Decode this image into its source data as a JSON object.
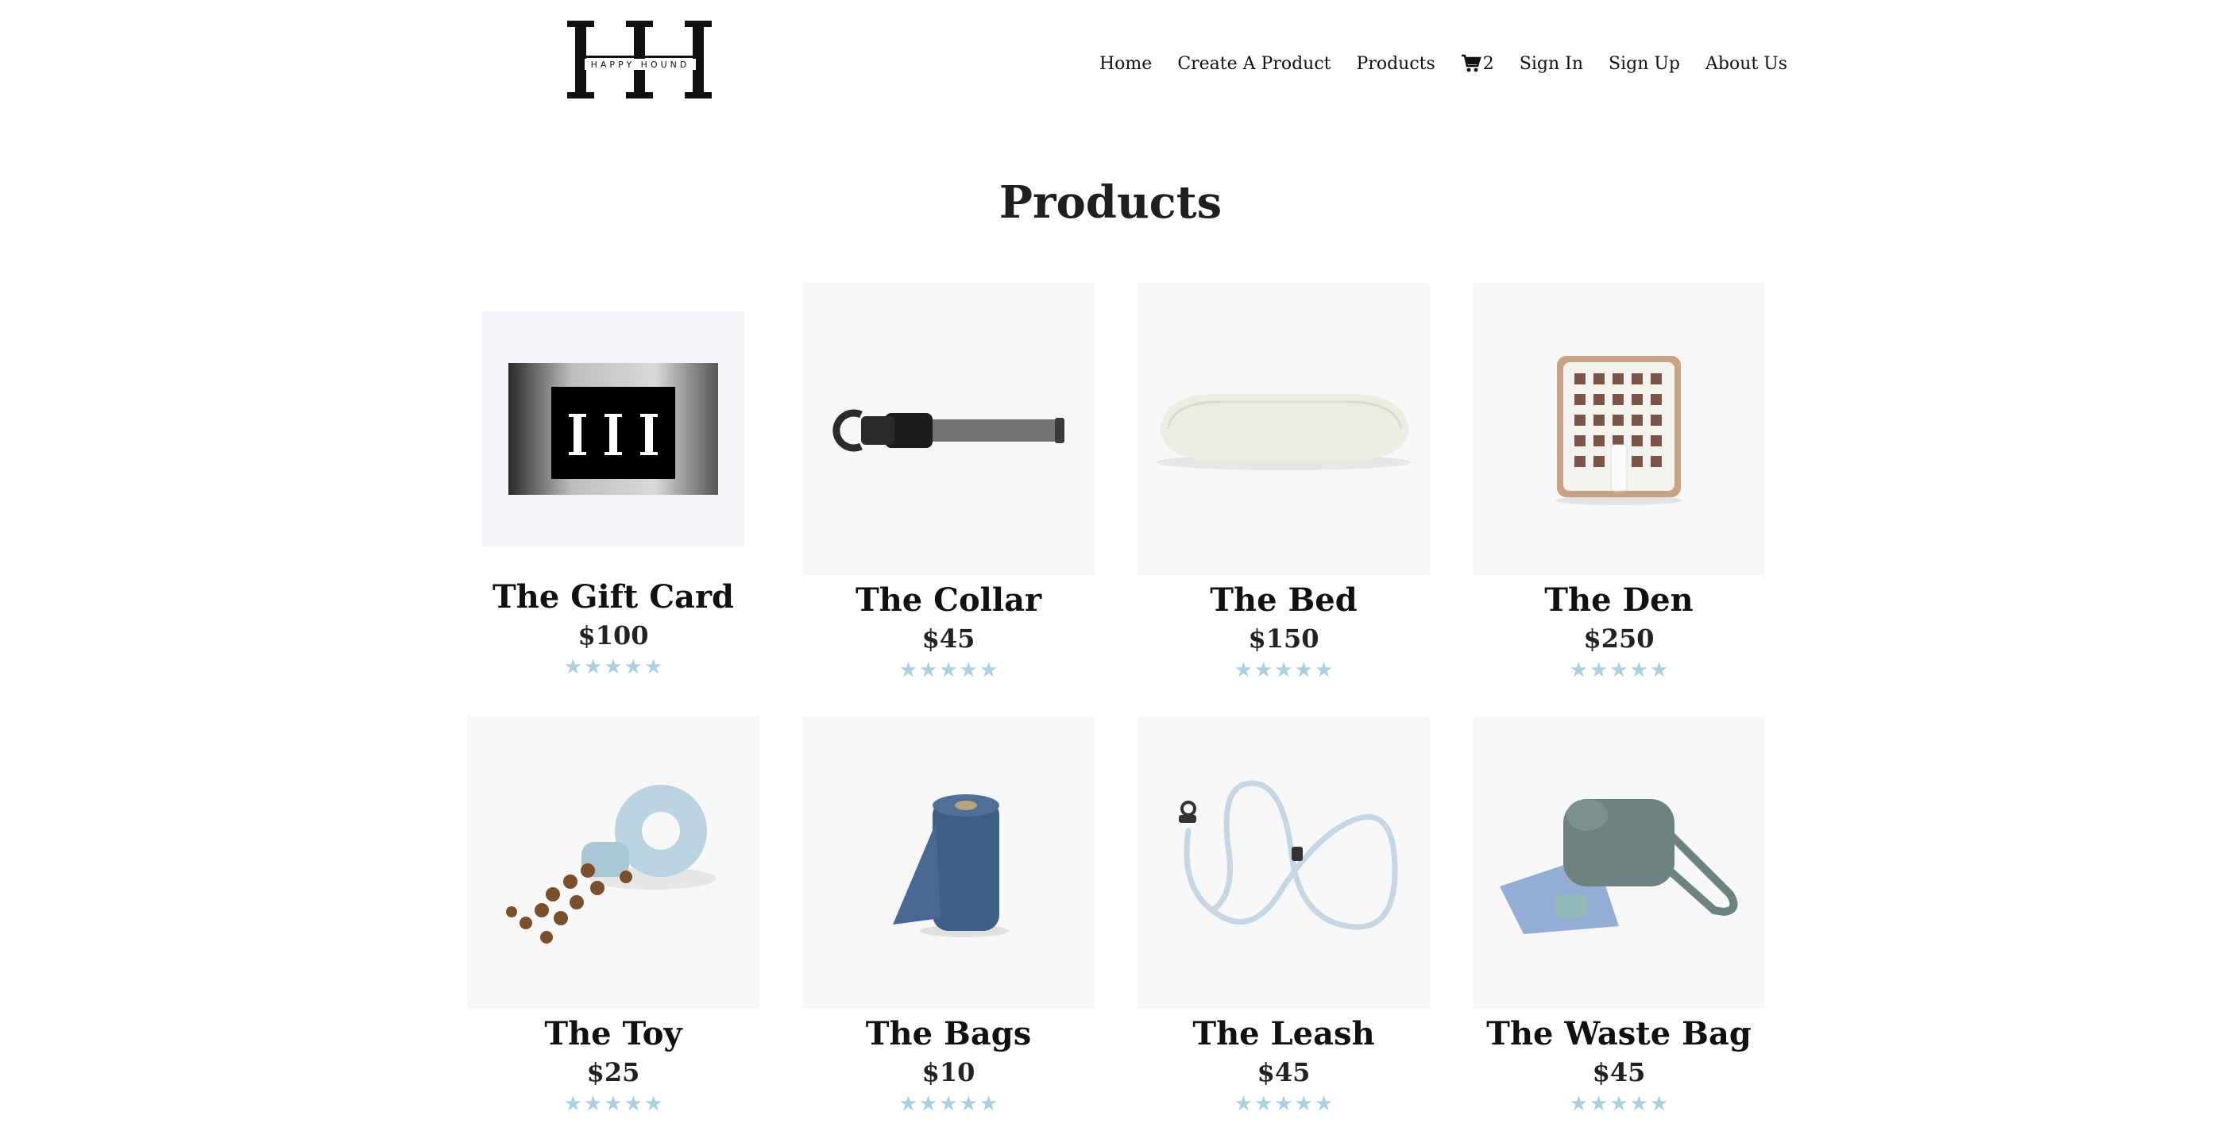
{
  "brand": {
    "logo_text": "HAPPY HOUND"
  },
  "nav": {
    "items": [
      "Home",
      "Create A Product",
      "Products"
    ],
    "cart_icon": "shopping-cart-icon",
    "cart_count": "2",
    "items_right": [
      "Sign In",
      "Sign Up",
      "About Us"
    ]
  },
  "page": {
    "title": "Products"
  },
  "colors": {
    "star": "#a9cfe0",
    "image_bg": "#f7f7f7"
  },
  "products": [
    {
      "name": "The Gift Card",
      "price": "$100",
      "rating": 0,
      "rating_max": 5
    },
    {
      "name": "The Collar",
      "price": "$45",
      "rating": 0,
      "rating_max": 5
    },
    {
      "name": "The Bed",
      "price": "$150",
      "rating": 0,
      "rating_max": 5
    },
    {
      "name": "The Den",
      "price": "$250",
      "rating": 0,
      "rating_max": 5
    },
    {
      "name": "The Toy",
      "price": "$25",
      "rating": 0,
      "rating_max": 5
    },
    {
      "name": "The Bags",
      "price": "$10",
      "rating": 0,
      "rating_max": 5
    },
    {
      "name": "The Leash",
      "price": "$45",
      "rating": 0,
      "rating_max": 5
    },
    {
      "name": "The Waste Bag",
      "price": "$45",
      "rating": 0,
      "rating_max": 5
    }
  ]
}
